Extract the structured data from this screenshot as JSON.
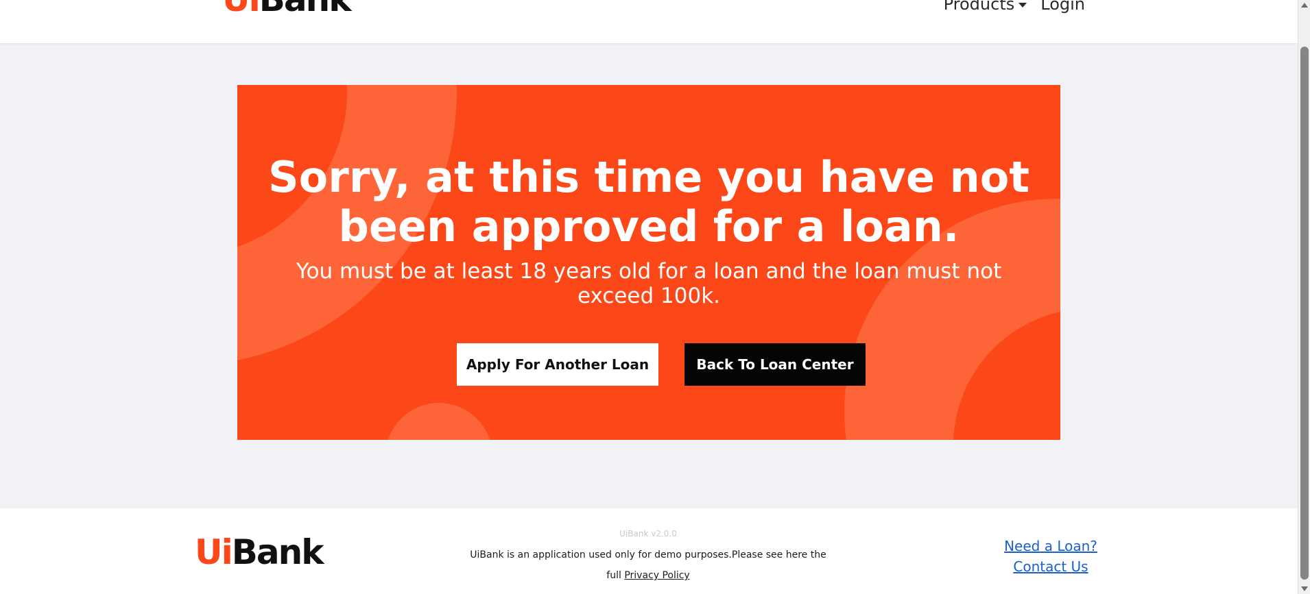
{
  "header": {
    "brand_ui": "Ui",
    "brand_bank": "Bank",
    "nav": {
      "products_label": "Products",
      "login_label": "Login"
    }
  },
  "hero": {
    "title": "Sorry, at this time you have not been approved for a loan.",
    "subtitle": "You must be at least 18 years old for a loan and the loan must not exceed 100k.",
    "apply_button_label": "Apply For Another Loan",
    "back_button_label": "Back To Loan Center"
  },
  "footer": {
    "brand_ui": "Ui",
    "brand_bank": "Bank",
    "version": "UiBank v2.0.0",
    "disclaimer_text": "UiBank is an application used only for demo purposes.Please see here the full",
    "privacy_link_label": "Privacy Policy",
    "need_loan_label": "Need a Loan?",
    "contact_label": "Contact Us"
  },
  "colors": {
    "brand_orange": "#fc4718",
    "decor_orange": "#fd6437",
    "dark_button": "#050505",
    "link_blue": "#1a5fd0",
    "page_background": "#f1f2f6"
  },
  "icons": {
    "products_caret": "caret-down-icon",
    "scroll_up": "arrow-up-icon",
    "scroll_down": "arrow-down-icon"
  }
}
